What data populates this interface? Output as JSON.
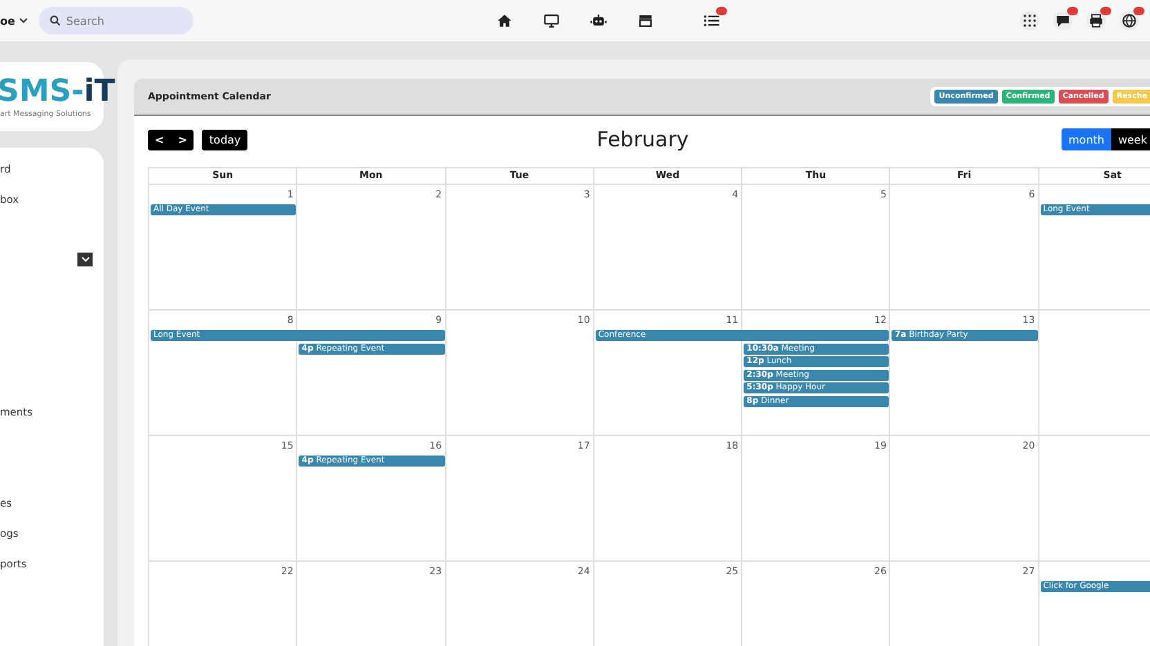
{
  "topbar": {
    "user": "oe",
    "search": {
      "placeholder": "Search"
    },
    "list_badge": true
  },
  "logo": {
    "parts": [
      "SMS-",
      "iT"
    ],
    "tagline": "art Messaging Solutions"
  },
  "sidebar": {
    "items": [
      {
        "kind": "text",
        "label": "rd"
      },
      {
        "kind": "text",
        "label": "box"
      },
      {
        "kind": "dropdown",
        "expanded": false
      },
      {
        "kind": "text",
        "label": "ments"
      },
      {
        "kind": "text",
        "label": "es"
      },
      {
        "kind": "text",
        "label": "ogs"
      },
      {
        "kind": "text",
        "label": "ports"
      }
    ]
  },
  "calendar": {
    "title": "Appointment Calendar",
    "legend": [
      {
        "label": "Unconfirmed",
        "color": "#3a87ad"
      },
      {
        "label": "Confirmed",
        "color": "#2bb57b"
      },
      {
        "label": "Cancelled",
        "color": "#dc4d55"
      },
      {
        "label": "Resche",
        "color": "#f2c94c"
      }
    ],
    "nav": {
      "prev": "<",
      "next": ">",
      "today": "today"
    },
    "month": "February",
    "views": [
      {
        "label": "month",
        "selected": true
      },
      {
        "label": "week",
        "selected": false
      }
    ],
    "columns": [
      "Sun",
      "Mon",
      "Tue",
      "Wed",
      "Thu",
      "Fri",
      "Sat"
    ],
    "weeks": [
      {
        "days": [
          {
            "number": "1",
            "events": [
              {
                "title": "All Day Event",
                "continues": false
              }
            ]
          },
          {
            "number": "2"
          },
          {
            "number": "3"
          },
          {
            "number": "4"
          },
          {
            "number": "5"
          },
          {
            "number": "6"
          },
          {
            "events": [
              {
                "title": "Long Event"
              }
            ]
          }
        ]
      },
      {
        "days": [
          {
            "number": "8",
            "events": [
              {
                "title": "Long Event",
                "continues": true
              }
            ]
          },
          {
            "number": "9",
            "events": [
              {
                "time": "4p",
                "title": "Repeating Event",
                "continues": false
              }
            ]
          },
          {
            "number": "10"
          },
          {
            "number": "11",
            "events": [
              {
                "title": "Conference",
                "continues": true
              }
            ]
          },
          {
            "number": "12",
            "events": [
              {
                "time": "10:30a",
                "title": "Meeting",
                "continues": false
              },
              {
                "time": "12p",
                "title": "Lunch",
                "continues": false
              },
              {
                "time": "2:30p",
                "title": "Meeting",
                "continues": false
              },
              {
                "time": "5:30p",
                "title": "Happy Hour",
                "continues": false
              },
              {
                "time": "8p",
                "title": "Dinner",
                "continues": false
              }
            ]
          },
          {
            "number": "13",
            "events": [
              {
                "time": "7a",
                "title": "Birthday Party",
                "continues": false
              }
            ]
          }
        ]
      },
      {
        "days": [
          {
            "number": "15"
          },
          {
            "number": "16",
            "events": [
              {
                "time": "4p",
                "title": "Repeating Event",
                "continues": false
              }
            ]
          },
          {
            "number": "17"
          },
          {
            "number": "18"
          },
          {
            "number": "19"
          },
          {
            "number": "20"
          }
        ]
      },
      {
        "days": [
          {
            "number": "22"
          },
          {
            "number": "23"
          },
          {
            "number": "24"
          },
          {
            "number": "25"
          },
          {
            "number": "26"
          },
          {
            "number": "27"
          },
          {
            "events": [
              {
                "title": "Click for Google"
              }
            ]
          }
        ]
      }
    ]
  }
}
